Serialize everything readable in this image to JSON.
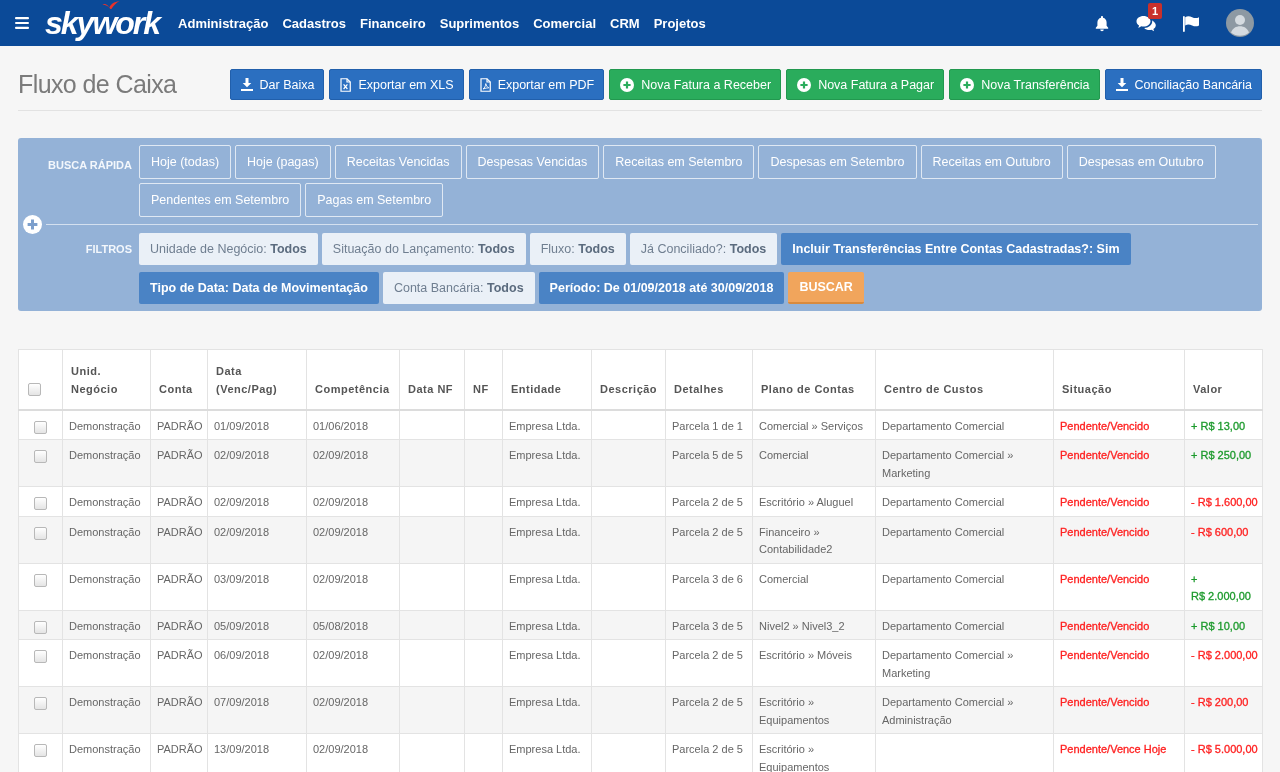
{
  "navbar": {
    "logo": "skywork",
    "menu": [
      "Administração",
      "Cadastros",
      "Financeiro",
      "Suprimentos",
      "Comercial",
      "CRM",
      "Projetos"
    ],
    "chat_badge": "1"
  },
  "page": {
    "title": "Fluxo de Caixa"
  },
  "actions": [
    {
      "label": "Dar Baixa",
      "kind": "download"
    },
    {
      "label": "Exportar em XLS",
      "kind": "xls"
    },
    {
      "label": "Exportar em PDF",
      "kind": "pdf"
    },
    {
      "label": "Nova Fatura a Receber",
      "kind": "add"
    },
    {
      "label": "Nova Fatura a Pagar",
      "kind": "add"
    },
    {
      "label": "Nova Transferência",
      "kind": "add"
    },
    {
      "label": "Conciliação Bancária",
      "kind": "download"
    }
  ],
  "quick_search": {
    "label": "BUSCA RÁPIDA",
    "buttons": [
      "Hoje (todas)",
      "Hoje (pagas)",
      "Receitas Vencidas",
      "Despesas Vencidas",
      "Receitas em Setembro",
      "Despesas em Setembro",
      "Receitas em Outubro",
      "Despesas em Outubro",
      "Pendentes em Setembro",
      "Pagas em Setembro"
    ]
  },
  "filters": {
    "label": "FILTROS",
    "chips": [
      {
        "name": "Unidade de Negócio:",
        "value": "Todos",
        "active": false
      },
      {
        "name": "Situação do Lançamento:",
        "value": "Todos",
        "active": false
      },
      {
        "name": "Fluxo:",
        "value": "Todos",
        "active": false
      },
      {
        "name": "Já Conciliado?:",
        "value": "Todos",
        "active": false
      },
      {
        "name": "Incluir Transferências Entre Contas Cadastradas?:",
        "value": "Sim",
        "active": true
      },
      {
        "name": "Tipo de Data:",
        "value": "Data de Movimentação",
        "active": true
      },
      {
        "name": "Conta Bancária:",
        "value": "Todos",
        "active": false
      },
      {
        "name": "Período:",
        "value": "De 01/09/2018 até 30/09/2018",
        "active": true
      }
    ],
    "search_button": "BUSCAR"
  },
  "table": {
    "select_all_checked": false,
    "columns": [
      "Unid. Negócio",
      "Conta",
      "Data (Venc/Pag)",
      "Competência",
      "Data NF",
      "NF",
      "Entidade",
      "Descrição",
      "Detalhes",
      "Plano de Contas",
      "Centro de Custos",
      "Situação",
      "Valor"
    ],
    "rows": [
      {
        "checked": false,
        "unit": "Demonstração",
        "account": "PADRÃO",
        "due_date": "01/09/2018",
        "competence": "01/06/2018",
        "entity": "Empresa Ltda.",
        "details": "Parcela 1 de 1",
        "chart_of_accounts": "Comercial » Serviços",
        "cost_center": "Departamento Comercial",
        "status": {
          "text": "Pendente/Vencido",
          "color": "#ff2020"
        },
        "amount": {
          "text": "+ R$ 13,00",
          "color": "#1c9a2c"
        }
      },
      {
        "checked": false,
        "unit": "Demonstração",
        "account": "PADRÃO",
        "due_date": "02/09/2018",
        "competence": "02/09/2018",
        "entity": "Empresa Ltda.",
        "details": "Parcela 5 de 5",
        "chart_of_accounts": "Comercial",
        "cost_center": "Departamento Comercial » Marketing",
        "status": {
          "text": "Pendente/Vencido",
          "color": "#ff2020"
        },
        "amount": {
          "text": "+ R$ 250,00",
          "color": "#1c9a2c"
        }
      },
      {
        "checked": false,
        "unit": "Demonstração",
        "account": "PADRÃO",
        "due_date": "02/09/2018",
        "competence": "02/09/2018",
        "entity": "Empresa Ltda.",
        "details": "Parcela 2 de 5",
        "chart_of_accounts": "Escritório » Aluguel",
        "cost_center": "Departamento Comercial",
        "status": {
          "text": "Pendente/Vencido",
          "color": "#ff2020"
        },
        "amount": {
          "text": "- R$ 1.600,00",
          "color": "#ff2020"
        }
      },
      {
        "checked": false,
        "unit": "Demonstração",
        "account": "PADRÃO",
        "due_date": "02/09/2018",
        "competence": "02/09/2018",
        "entity": "Empresa Ltda.",
        "details": "Parcela 2 de 5",
        "chart_of_accounts": "Financeiro » Contabilidade2",
        "cost_center": "Departamento Comercial",
        "status": {
          "text": "Pendente/Vencido",
          "color": "#ff2020"
        },
        "amount": {
          "text": "- R$ 600,00",
          "color": "#ff2020"
        }
      },
      {
        "checked": false,
        "unit": "Demonstração",
        "account": "PADRÃO",
        "due_date": "03/09/2018",
        "competence": "02/09/2018",
        "entity": "Empresa Ltda.",
        "details": "Parcela 3 de 6",
        "chart_of_accounts": "Comercial",
        "cost_center": "Departamento Comercial",
        "status": {
          "text": "Pendente/Vencido",
          "color": "#ff2020"
        },
        "amount": {
          "text": "+ R$ 2.000,00",
          "color": "#1c9a2c"
        }
      },
      {
        "checked": false,
        "unit": "Demonstração",
        "account": "PADRÃO",
        "due_date": "05/09/2018",
        "competence": "05/08/2018",
        "entity": "Empresa Ltda.",
        "details": "Parcela 3 de 5",
        "chart_of_accounts": "Nivel2 » Nivel3_2",
        "cost_center": "Departamento Comercial",
        "status": {
          "text": "Pendente/Vencido",
          "color": "#ff2020"
        },
        "amount": {
          "text": "+ R$ 10,00",
          "color": "#1c9a2c"
        }
      },
      {
        "checked": false,
        "unit": "Demonstração",
        "account": "PADRÃO",
        "due_date": "06/09/2018",
        "competence": "02/09/2018",
        "entity": "Empresa Ltda.",
        "details": "Parcela 2 de 5",
        "chart_of_accounts": "Escritório » Móveis",
        "cost_center": "Departamento Comercial » Marketing",
        "status": {
          "text": "Pendente/Vencido",
          "color": "#ff2020"
        },
        "amount": {
          "text": "- R$ 2.000,00",
          "color": "#ff2020"
        }
      },
      {
        "checked": false,
        "unit": "Demonstração",
        "account": "PADRÃO",
        "due_date": "07/09/2018",
        "competence": "02/09/2018",
        "entity": "Empresa Ltda.",
        "details": "Parcela 2 de 5",
        "chart_of_accounts": "Escritório » Equipamentos",
        "cost_center": "Departamento Comercial » Administração",
        "status": {
          "text": "Pendente/Vencido",
          "color": "#ff2020"
        },
        "amount": {
          "text": "- R$ 200,00",
          "color": "#ff2020"
        }
      },
      {
        "checked": false,
        "unit": "Demonstração",
        "account": "PADRÃO",
        "due_date": "13/09/2018",
        "competence": "02/09/2018",
        "entity": "Empresa Ltda.",
        "details": "Parcela 2 de 5",
        "chart_of_accounts": "Escritório » Equipamentos",
        "status": {
          "text": "Pendente/Vence Hoje",
          "color": "#ff2020"
        },
        "amount": {
          "text": "- R$ 5.000,00",
          "color": "#ff2020"
        }
      }
    ]
  }
}
